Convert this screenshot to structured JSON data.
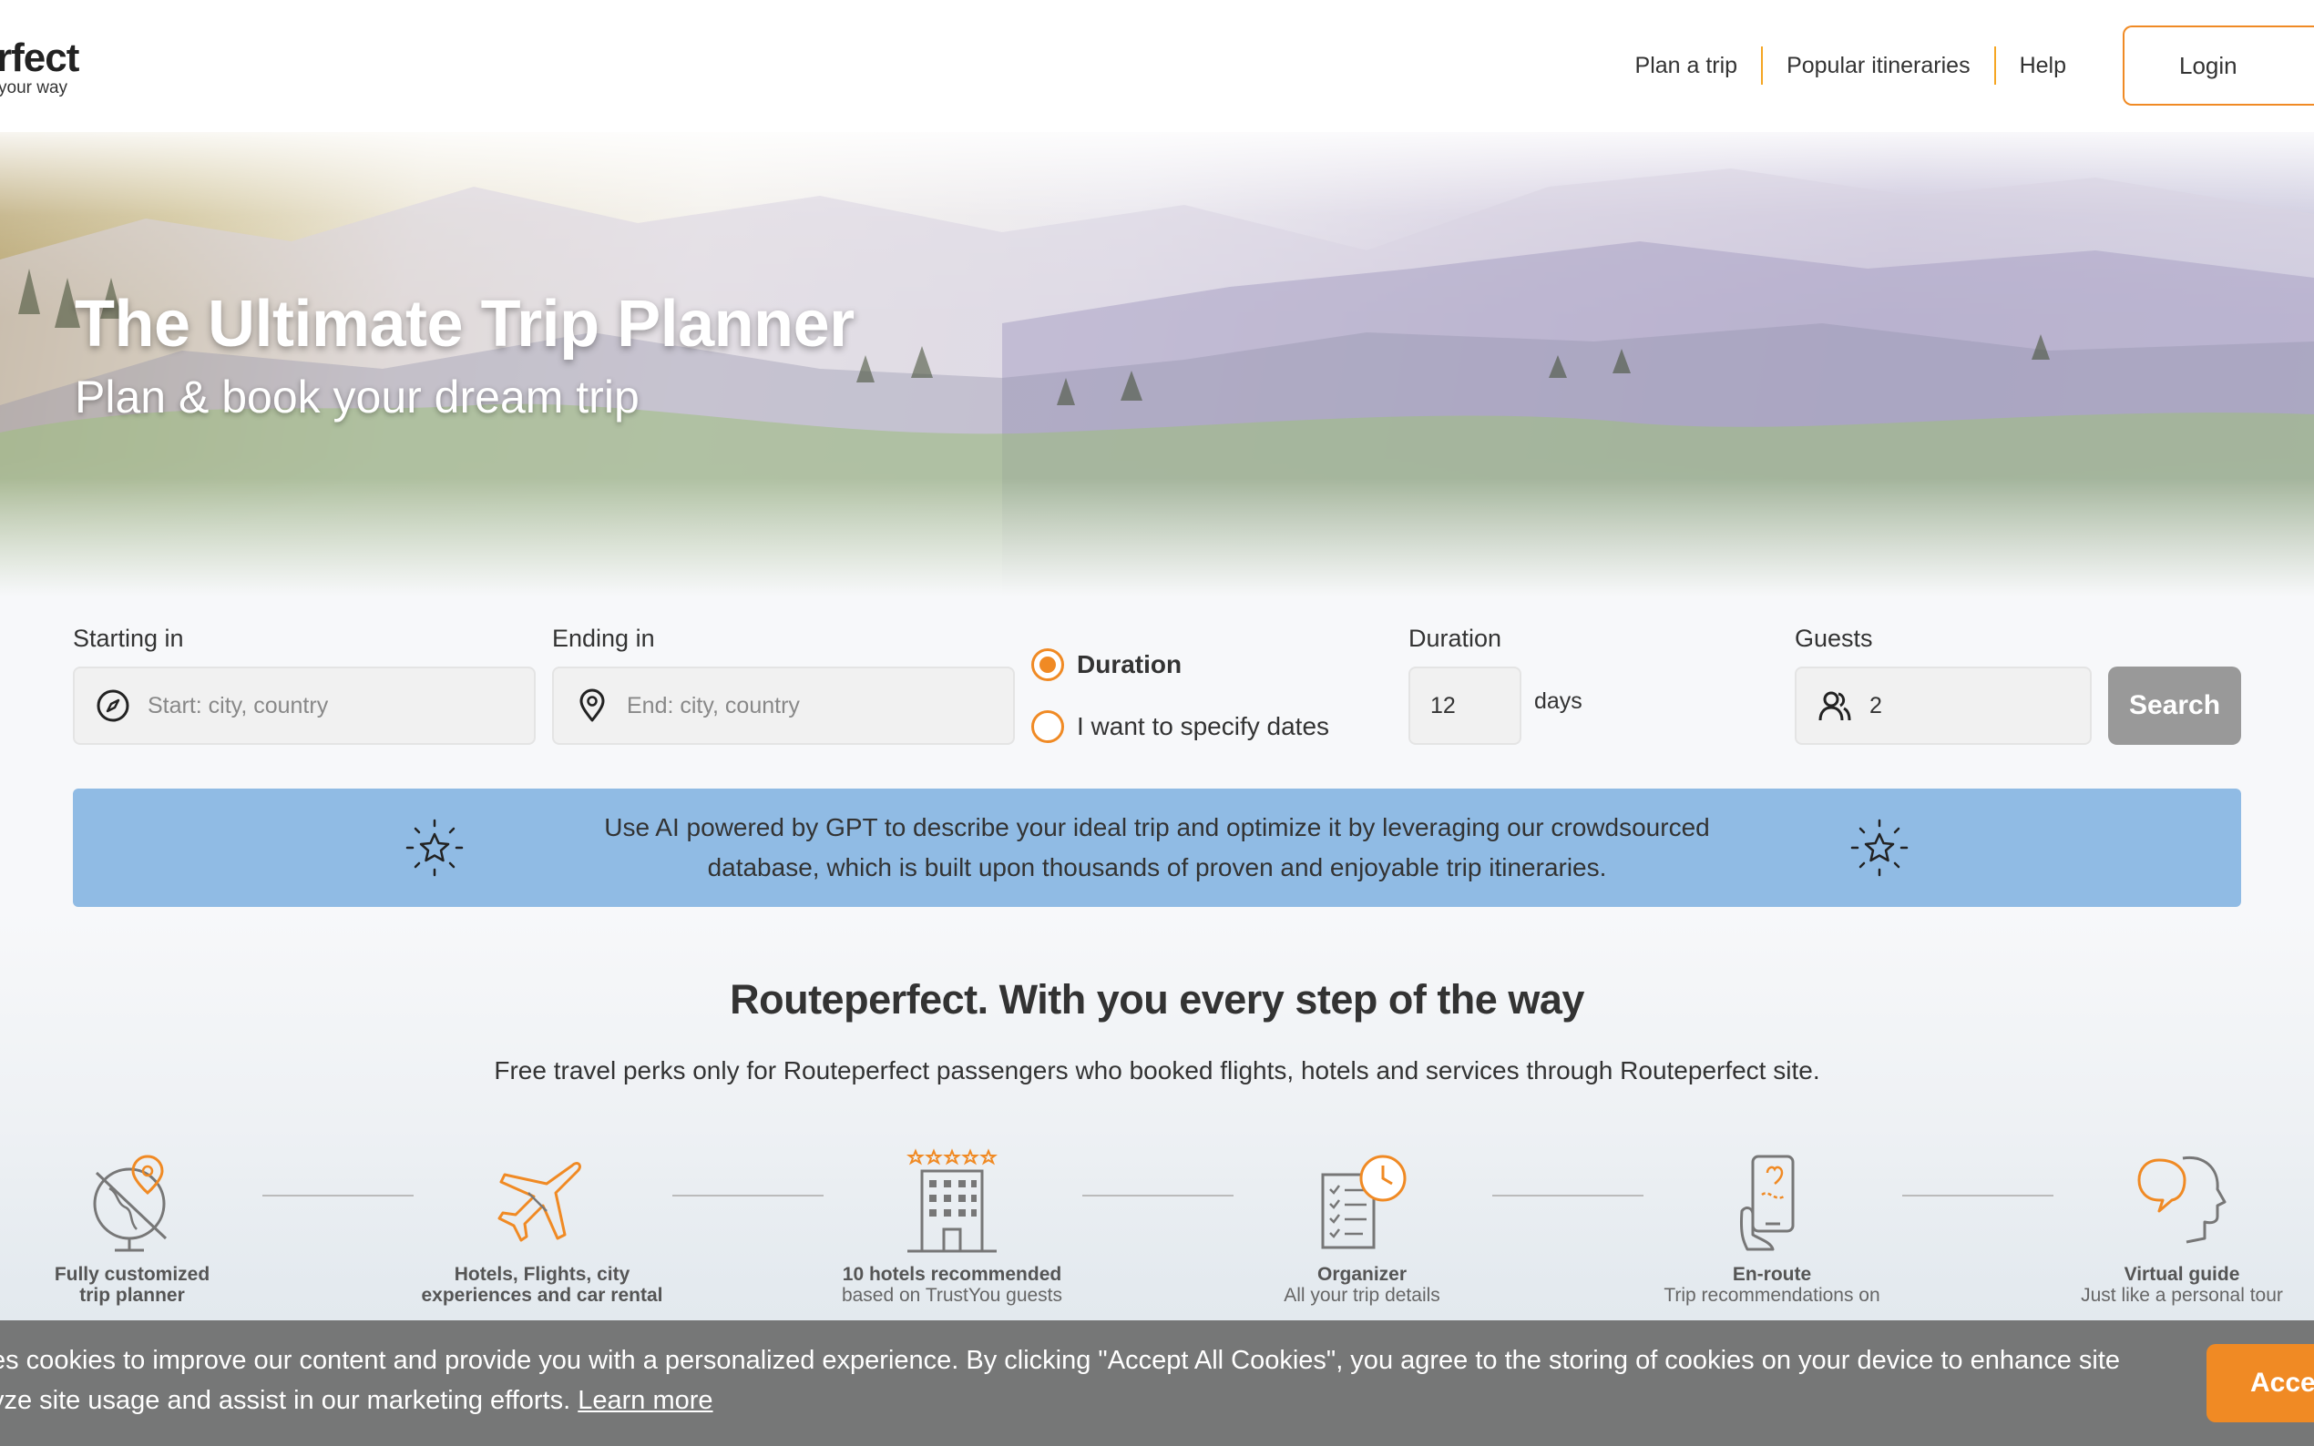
{
  "header": {
    "logo_main": "rfect",
    "logo_tag": "your way",
    "nav": [
      "Plan a trip",
      "Popular itineraries",
      "Help"
    ],
    "login_label": "Login"
  },
  "hero": {
    "title": "The Ultimate Trip Planner",
    "subtitle": "Plan & book your dream trip"
  },
  "search": {
    "start_label": "Starting in",
    "start_placeholder": "Start: city, country",
    "end_label": "Ending in",
    "end_placeholder": "End: city, country",
    "radio_duration": "Duration",
    "radio_dates": "I want to specify dates",
    "duration_label": "Duration",
    "duration_value": "12",
    "days_label": "days",
    "guests_label": "Guests",
    "guests_value": "2",
    "search_label": "Search"
  },
  "ai_banner": {
    "line1": "Use AI powered by GPT to describe your ideal trip and optimize it by leveraging our crowdsourced",
    "line2": "database, which is built upon thousands of proven and enjoyable trip itineraries."
  },
  "perks": {
    "title": "Routeperfect. With you every step of the way",
    "subtitle": "Free travel perks only for Routeperfect passengers who booked flights, hotels and services through Routeperfect site.",
    "items": [
      {
        "name1": "Fully customized",
        "name2": "trip planner",
        "icon": "globe-map-icon"
      },
      {
        "name1": "Hotels, Flights, city",
        "name2": "experiences and car rental",
        "icon": "airplane-icon"
      },
      {
        "name1": "10 hotels recommended",
        "desc": "based on TrustYou guests",
        "icon": "hotel-stars-icon"
      },
      {
        "name1": "Organizer",
        "desc": "All your trip details",
        "icon": "checklist-clock-icon"
      },
      {
        "name1": "En-route",
        "desc": "Trip recommendations on",
        "icon": "phone-map-icon"
      },
      {
        "name1": "Virtual guide",
        "desc": "Just like a personal tour",
        "icon": "speech-head-icon"
      }
    ]
  },
  "cookie": {
    "line1": "es cookies to improve our content and provide you with a personalized experience. By clicking \"Accept All Cookies\", you agree to the storing of cookies on your device to enhance site",
    "line2": "yze site usage and assist in our marketing efforts.",
    "learn_more": "Learn more",
    "accept_label": "Accep"
  },
  "colors": {
    "accent": "#f08a24",
    "banner": "#90bbe4",
    "search_button": "#999999",
    "cookie_bar": "#6e6e6e"
  }
}
